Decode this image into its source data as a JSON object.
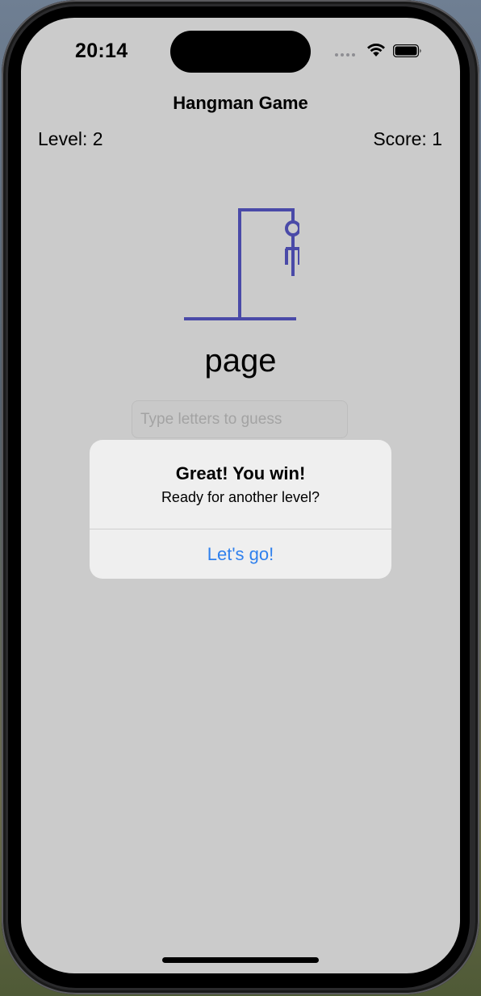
{
  "status_bar": {
    "time": "20:14"
  },
  "nav": {
    "title": "Hangman Game"
  },
  "game": {
    "level_text": "Level: 2",
    "score_text": "Score: 1",
    "word": "page",
    "guess_placeholder": "Type letters to guess",
    "guess_value": ""
  },
  "alert": {
    "title": "Great! You win!",
    "message": "Ready for another level?",
    "button_label": "Let's go!"
  },
  "colors": {
    "drawing": "#4a4aa8",
    "accent": "#2f80ed",
    "background": "#cbcbcb"
  },
  "icons": [
    "signal-icon",
    "wifi-icon",
    "battery-icon"
  ]
}
